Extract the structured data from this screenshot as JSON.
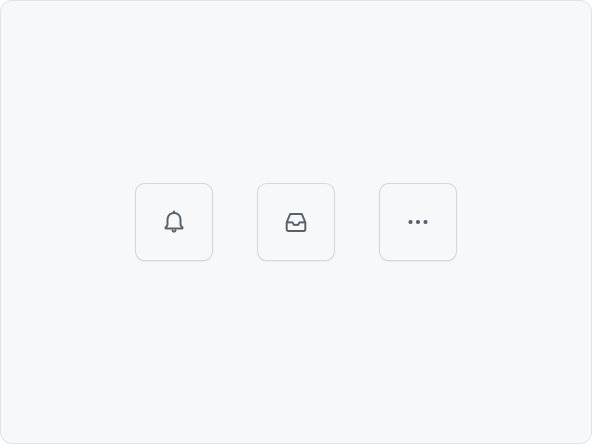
{
  "toolbar": {
    "buttons": [
      {
        "icon": "bell-icon",
        "purpose": "notifications"
      },
      {
        "icon": "inbox-icon",
        "purpose": "inbox"
      },
      {
        "icon": "kebab-horizontal-icon",
        "purpose": "more options"
      }
    ]
  },
  "colors": {
    "panel_background": "#f6f8fa",
    "panel_border": "#e0e3e7",
    "button_border": "#d4d8dd",
    "icon_color": "#59636e"
  }
}
